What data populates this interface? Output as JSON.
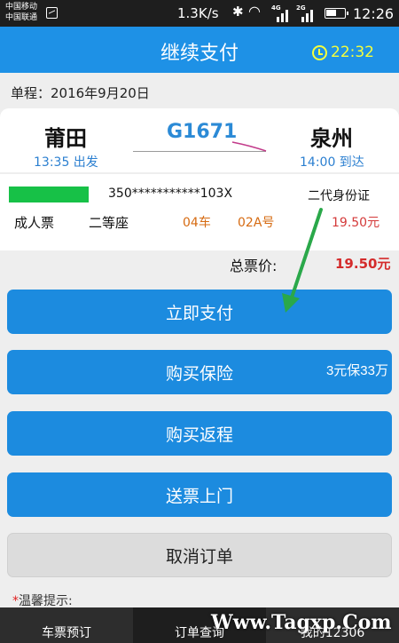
{
  "status_bar": {
    "carrier_1": "中国移动",
    "carrier_2": "中国联通",
    "speed": "1.3K/s",
    "time": "12:26",
    "net_1": "4G",
    "net_2": "2G"
  },
  "header": {
    "title": "继续支付",
    "countdown": "22:32"
  },
  "trip": {
    "date_label": "单程：2016年9月20日",
    "from": "莆田",
    "to": "泉州",
    "train_no": "G1671",
    "departure": "13:35 出发",
    "arrival": "14:00 到达"
  },
  "passenger": {
    "id_number": "350***********103X",
    "id_type": "二代身份证",
    "ticket_type": "成人票",
    "seat_class": "二等座",
    "car": "04车",
    "seat": "02A号",
    "price": "19.50元"
  },
  "total": {
    "label": "总票价:",
    "value": "19.50元"
  },
  "actions": {
    "pay": "立即支付",
    "insurance": "购买保险",
    "insurance_note": "3元保33万",
    "return": "购买返程",
    "deliver": "送票上门",
    "cancel": "取消订单"
  },
  "tip": {
    "star": "*",
    "label": "温馨提示:"
  },
  "bottom_nav": [
    "车票预订",
    "订单查询",
    "我的12306"
  ],
  "watermark": "Www.Tagxp.Com",
  "colors": {
    "primary": "#1e91e6",
    "button": "#1c8bdf",
    "countdown": "#f4ff3d",
    "price": "#d43a3a",
    "seat": "#d66b12",
    "annotation_arrow": "#2aa84a"
  }
}
